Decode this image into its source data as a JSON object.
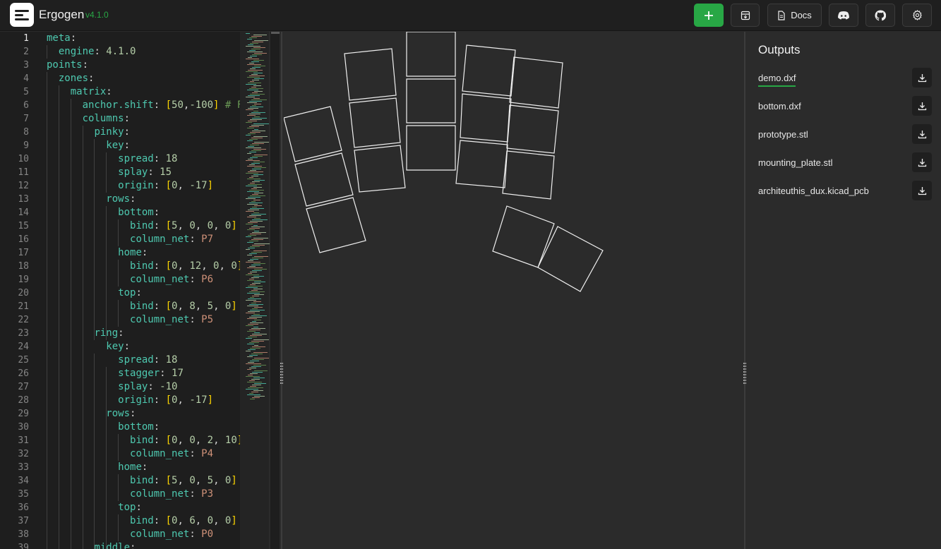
{
  "header": {
    "app_name": "Ergogen",
    "version": "v4.1.0",
    "docs_label": "Docs",
    "buttons": {
      "add": "plus-icon",
      "save": "download-box-icon",
      "docs": "document-icon",
      "discord": "discord-icon",
      "github": "github-icon",
      "settings": "gear-icon"
    }
  },
  "editor": {
    "current_line": 1,
    "line_numbers": [
      "1",
      "2",
      "3",
      "4",
      "5",
      "6",
      "7",
      "8",
      "9",
      "10",
      "11",
      "12",
      "13",
      "14",
      "15",
      "16",
      "17",
      "18",
      "19",
      "20",
      "21",
      "22",
      "23",
      "24",
      "25",
      "26",
      "27",
      "28",
      "29",
      "30",
      "31",
      "32",
      "33",
      "34",
      "35",
      "36",
      "37",
      "38",
      "39"
    ],
    "lines": [
      [
        [
          "k",
          "meta"
        ],
        [
          "p",
          ":"
        ]
      ],
      [
        [
          "k",
          "engine"
        ],
        [
          "p",
          ": "
        ],
        [
          "n",
          "4.1.0"
        ]
      ],
      [
        [
          "k",
          "points"
        ],
        [
          "p",
          ":"
        ]
      ],
      [
        [
          "k",
          "zones"
        ],
        [
          "p",
          ":"
        ]
      ],
      [
        [
          "k",
          "matrix"
        ],
        [
          "p",
          ":"
        ]
      ],
      [
        [
          "k",
          "anchor.shift"
        ],
        [
          "p",
          ": "
        ],
        [
          "b",
          "["
        ],
        [
          "n",
          "50"
        ],
        [
          "p",
          ","
        ],
        [
          "n",
          "-100"
        ],
        [
          "b",
          "]"
        ],
        [
          "c",
          " # F"
        ]
      ],
      [
        [
          "k",
          "columns"
        ],
        [
          "p",
          ":"
        ]
      ],
      [
        [
          "k",
          "pinky"
        ],
        [
          "p",
          ":"
        ]
      ],
      [
        [
          "k",
          "key"
        ],
        [
          "p",
          ":"
        ]
      ],
      [
        [
          "k",
          "spread"
        ],
        [
          "p",
          ": "
        ],
        [
          "n",
          "18"
        ]
      ],
      [
        [
          "k",
          "splay"
        ],
        [
          "p",
          ": "
        ],
        [
          "n",
          "15"
        ]
      ],
      [
        [
          "k",
          "origin"
        ],
        [
          "p",
          ": "
        ],
        [
          "b",
          "["
        ],
        [
          "n",
          "0"
        ],
        [
          "p",
          ", "
        ],
        [
          "n",
          "-17"
        ],
        [
          "b",
          "]"
        ]
      ],
      [
        [
          "k",
          "rows"
        ],
        [
          "p",
          ":"
        ]
      ],
      [
        [
          "k",
          "bottom"
        ],
        [
          "p",
          ":"
        ]
      ],
      [
        [
          "k",
          "bind"
        ],
        [
          "p",
          ": "
        ],
        [
          "b",
          "["
        ],
        [
          "n",
          "5"
        ],
        [
          "p",
          ", "
        ],
        [
          "n",
          "0"
        ],
        [
          "p",
          ", "
        ],
        [
          "n",
          "0"
        ],
        [
          "p",
          ", "
        ],
        [
          "n",
          "0"
        ],
        [
          "b",
          "]"
        ]
      ],
      [
        [
          "k",
          "column_net"
        ],
        [
          "p",
          ": "
        ],
        [
          "s",
          "P7"
        ]
      ],
      [
        [
          "k",
          "home"
        ],
        [
          "p",
          ":"
        ]
      ],
      [
        [
          "k",
          "bind"
        ],
        [
          "p",
          ": "
        ],
        [
          "b",
          "["
        ],
        [
          "n",
          "0"
        ],
        [
          "p",
          ", "
        ],
        [
          "n",
          "12"
        ],
        [
          "p",
          ", "
        ],
        [
          "n",
          "0"
        ],
        [
          "p",
          ", "
        ],
        [
          "n",
          "0"
        ],
        [
          "b",
          "]"
        ]
      ],
      [
        [
          "k",
          "column_net"
        ],
        [
          "p",
          ": "
        ],
        [
          "s",
          "P6"
        ]
      ],
      [
        [
          "k",
          "top"
        ],
        [
          "p",
          ":"
        ]
      ],
      [
        [
          "k",
          "bind"
        ],
        [
          "p",
          ": "
        ],
        [
          "b",
          "["
        ],
        [
          "n",
          "0"
        ],
        [
          "p",
          ", "
        ],
        [
          "n",
          "8"
        ],
        [
          "p",
          ", "
        ],
        [
          "n",
          "5"
        ],
        [
          "p",
          ", "
        ],
        [
          "n",
          "0"
        ],
        [
          "b",
          "]"
        ]
      ],
      [
        [
          "k",
          "column_net"
        ],
        [
          "p",
          ": "
        ],
        [
          "s",
          "P5"
        ]
      ],
      [
        [
          "k",
          "ring"
        ],
        [
          "p",
          ":"
        ]
      ],
      [
        [
          "k",
          "key"
        ],
        [
          "p",
          ":"
        ]
      ],
      [
        [
          "k",
          "spread"
        ],
        [
          "p",
          ": "
        ],
        [
          "n",
          "18"
        ]
      ],
      [
        [
          "k",
          "stagger"
        ],
        [
          "p",
          ": "
        ],
        [
          "n",
          "17"
        ]
      ],
      [
        [
          "k",
          "splay"
        ],
        [
          "p",
          ": "
        ],
        [
          "n",
          "-10"
        ]
      ],
      [
        [
          "k",
          "origin"
        ],
        [
          "p",
          ": "
        ],
        [
          "b",
          "["
        ],
        [
          "n",
          "0"
        ],
        [
          "p",
          ", "
        ],
        [
          "n",
          "-17"
        ],
        [
          "b",
          "]"
        ]
      ],
      [
        [
          "k",
          "rows"
        ],
        [
          "p",
          ":"
        ]
      ],
      [
        [
          "k",
          "bottom"
        ],
        [
          "p",
          ":"
        ]
      ],
      [
        [
          "k",
          "bind"
        ],
        [
          "p",
          ": "
        ],
        [
          "b",
          "["
        ],
        [
          "n",
          "0"
        ],
        [
          "p",
          ", "
        ],
        [
          "n",
          "0"
        ],
        [
          "p",
          ", "
        ],
        [
          "n",
          "2"
        ],
        [
          "p",
          ", "
        ],
        [
          "n",
          "10"
        ],
        [
          "b",
          "]"
        ]
      ],
      [
        [
          "k",
          "column_net"
        ],
        [
          "p",
          ": "
        ],
        [
          "s",
          "P4"
        ]
      ],
      [
        [
          "k",
          "home"
        ],
        [
          "p",
          ":"
        ]
      ],
      [
        [
          "k",
          "bind"
        ],
        [
          "p",
          ": "
        ],
        [
          "b",
          "["
        ],
        [
          "n",
          "5"
        ],
        [
          "p",
          ", "
        ],
        [
          "n",
          "0"
        ],
        [
          "p",
          ", "
        ],
        [
          "n",
          "5"
        ],
        [
          "p",
          ", "
        ],
        [
          "n",
          "0"
        ],
        [
          "b",
          "]"
        ]
      ],
      [
        [
          "k",
          "column_net"
        ],
        [
          "p",
          ": "
        ],
        [
          "s",
          "P3"
        ]
      ],
      [
        [
          "k",
          "top"
        ],
        [
          "p",
          ":"
        ]
      ],
      [
        [
          "k",
          "bind"
        ],
        [
          "p",
          ": "
        ],
        [
          "b",
          "["
        ],
        [
          "n",
          "0"
        ],
        [
          "p",
          ", "
        ],
        [
          "n",
          "6"
        ],
        [
          "p",
          ", "
        ],
        [
          "n",
          "0"
        ],
        [
          "p",
          ", "
        ],
        [
          "n",
          "0"
        ],
        [
          "b",
          "]"
        ]
      ],
      [
        [
          "k",
          "column_net"
        ],
        [
          "p",
          ": "
        ],
        [
          "s",
          "P0"
        ]
      ],
      [
        [
          "k",
          "middle"
        ],
        [
          "p",
          ":"
        ]
      ]
    ]
  },
  "outputs": {
    "title": "Outputs",
    "active": 0,
    "files": [
      "demo.dxf",
      "bottom.dxf",
      "prototype.stl",
      "mounting_plate.stl",
      "architeuthis_dux.kicad_pcb"
    ],
    "download_icon": "download-icon"
  }
}
